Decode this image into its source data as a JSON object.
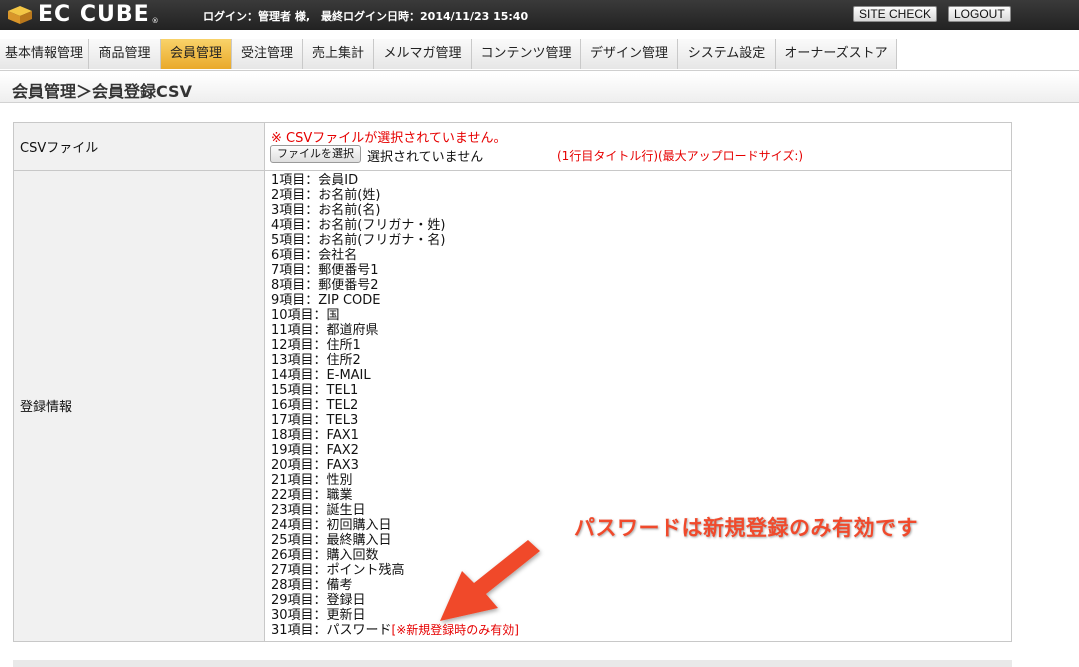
{
  "header": {
    "logo_text": "EC CUBE",
    "logo_tm": "®",
    "login_info": "ログイン：管理者 様,　最終ログイン日時：2014/11/23 15:40",
    "site_check_label": "SITE CHECK",
    "logout_label": "LOGOUT"
  },
  "nav": {
    "items": [
      {
        "label": "基本情報管理"
      },
      {
        "label": "商品管理"
      },
      {
        "label": "会員管理"
      },
      {
        "label": "受注管理"
      },
      {
        "label": "売上集計"
      },
      {
        "label": "メルマガ管理"
      },
      {
        "label": "コンテンツ管理"
      },
      {
        "label": "デザイン管理"
      },
      {
        "label": "システム設定"
      },
      {
        "label": "オーナーズストア"
      }
    ],
    "active": "会員管理"
  },
  "page": {
    "title": "会員管理＞会員登録CSV"
  },
  "form": {
    "csv_label": "CSVファイル",
    "error": "※ CSVファイルが選択されていません。",
    "file_button": "ファイルを選択",
    "file_status": "選択されていません",
    "upload_note": "(1行目タイトル行)(最大アップロードサイズ:)",
    "info_label": "登録情報",
    "fields": [
      "1項目：会員ID",
      "2項目：お名前(姓)",
      "3項目：お名前(名)",
      "4項目：お名前(フリガナ・姓)",
      "5項目：お名前(フリガナ・名)",
      "6項目：会社名",
      "7項目：郵便番号1",
      "8項目：郵便番号2",
      "9項目：ZIP CODE",
      "10項目：国",
      "11項目：都道府県",
      "12項目：住所1",
      "13項目：住所2",
      "14項目：E-MAIL",
      "15項目：TEL1",
      "16項目：TEL2",
      "17項目：TEL3",
      "18項目：FAX1",
      "19項目：FAX2",
      "20項目：FAX3",
      "21項目：性別",
      "22項目：職業",
      "23項目：誕生日",
      "24項目：初回購入日",
      "25項目：最終購入日",
      "26項目：購入回数",
      "27項目：ポイント残高",
      "28項目：備考",
      "29項目：登録日",
      "30項目：更新日",
      "31項目：パスワード"
    ],
    "last_field_note": "[※新規登録時のみ有効]"
  },
  "annotation": {
    "text": "パスワードは新規登録のみ有効です"
  },
  "colors": {
    "accent": "#f0a830",
    "error": "#e60000",
    "annotation": "#f04a2c"
  }
}
